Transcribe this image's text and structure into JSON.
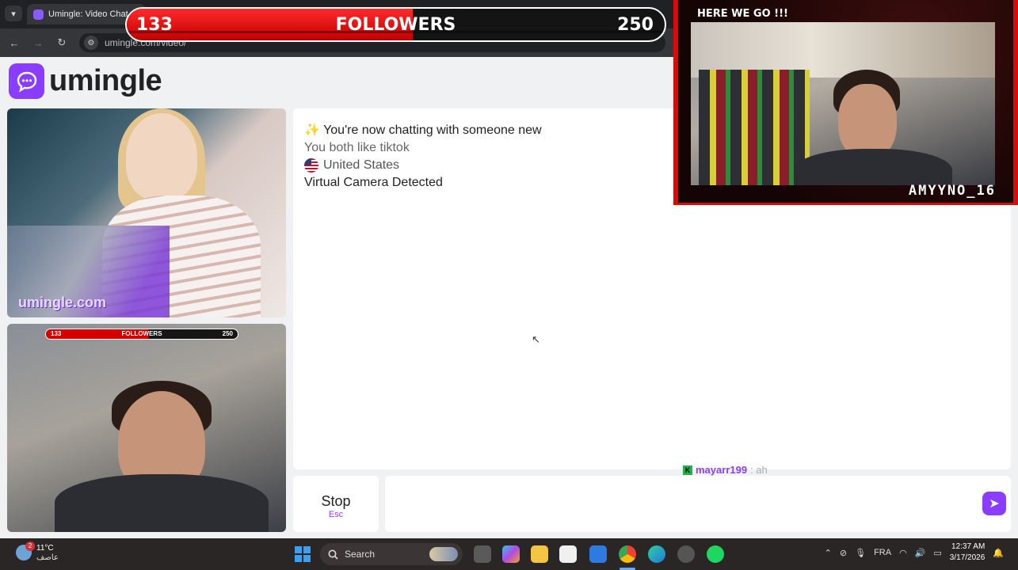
{
  "browser": {
    "tab_title": "Umingle: Video Chat w",
    "url": "umingle.com/video/"
  },
  "followers_bar": {
    "current": "133",
    "label": "FOLLOWERS",
    "goal": "250",
    "progress": 0.532,
    "color": "#d80000"
  },
  "site": {
    "brand": "umingle",
    "accent": "#8b3dff"
  },
  "stranger_video": {
    "watermark": "umingle.com"
  },
  "self_video": {
    "mini_bar": {
      "current": "133",
      "label": "FOLLOWERS",
      "goal": "250"
    }
  },
  "chat": {
    "intro_emoji": "✨",
    "intro": "You're now chatting with someone new",
    "interest": "You both like tiktok",
    "country": "United States",
    "notice": "Virtual Camera Detected"
  },
  "controls": {
    "stop_label": "Stop",
    "stop_key": "Esc",
    "send_icon": "send-arrow-icon"
  },
  "stream_overlay": {
    "top_text": "HERE WE GO !!!",
    "streamer_name": "AMYYNO_16",
    "frame_color": "#d80a0a",
    "chat_user": "mayarr199",
    "chat_text": ": ah"
  },
  "taskbar": {
    "weather_temp": "11°C",
    "weather_desc": "عاصف",
    "weather_badge": "2",
    "search_label": "Search",
    "language": "FRA",
    "time": "12:37 AM",
    "date": "3/17/2026"
  }
}
